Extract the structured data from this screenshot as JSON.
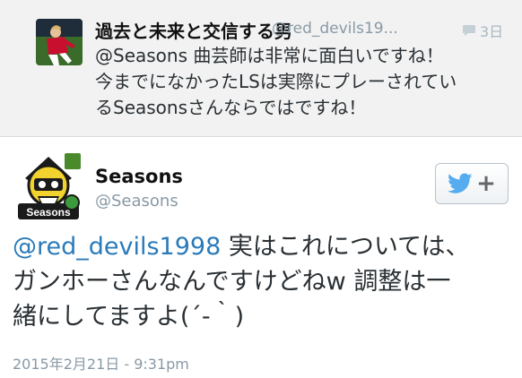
{
  "reply": {
    "display_name": "過去と未来と交信する男",
    "handle": "@red_devils19...",
    "reply_count": "3日",
    "text_lines": [
      "@Seasons 曲芸師は非常に面白いですね！",
      "今までになかったLSは実際にプレーされてい",
      "るSeasonsさんならではですね！"
    ]
  },
  "tweet": {
    "display_name": "Seasons",
    "handle": "@Seasons",
    "avatar_caption": "Seasons",
    "mention": "@red_devils1998",
    "line1_rest": " 実はこれについては、",
    "line2": "ガンホーさんなんですけどねw 調整は一",
    "line3": "緒にしてますよ(´-｀)",
    "timestamp": "2015年2月21日 - 9:31pm"
  },
  "colors": {
    "link": "#2b7bb9",
    "twitter_blue": "#55acee",
    "muted": "#8899a6"
  }
}
